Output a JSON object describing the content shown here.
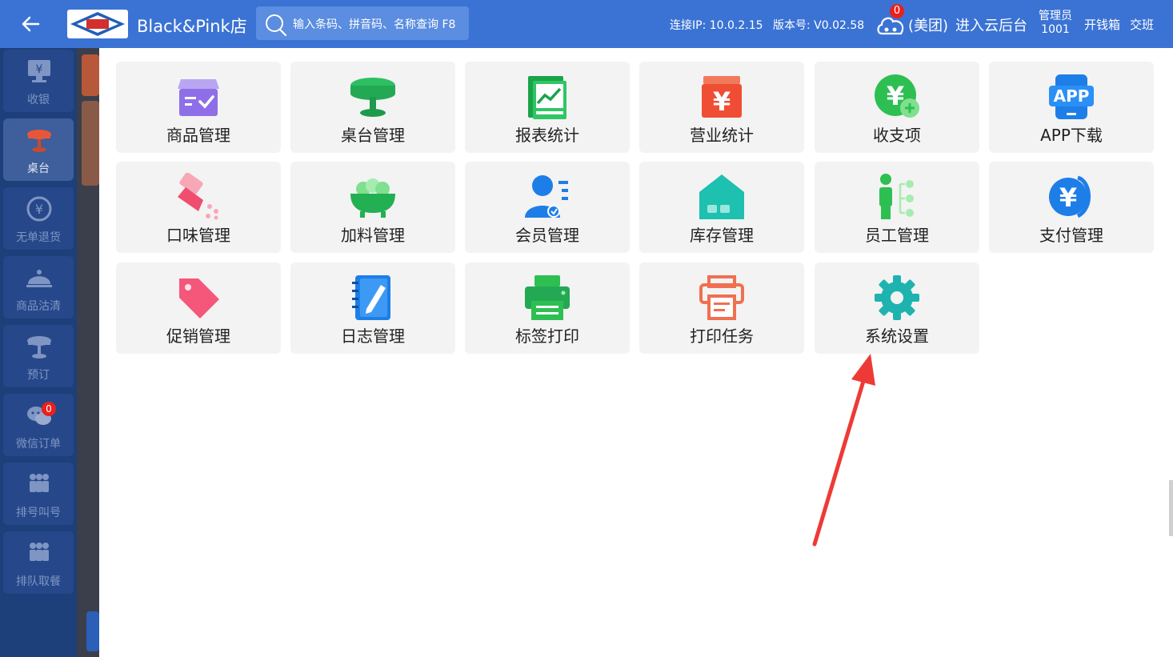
{
  "header": {
    "shop_name": "Black&Pink店",
    "search_placeholder": "输入条码、拼音码、名称查询 F8",
    "ip": "连接IP: 10.0.2.15",
    "version": "版本号: V0.02.58",
    "cloud_badge": "0",
    "meituan": "(美团)",
    "cloud_backend": "进入云后台",
    "admin_role": "管理员",
    "admin_id": "1001",
    "cash_box": "开钱箱",
    "shift": "交班"
  },
  "sidebar": {
    "items": [
      {
        "label": "收银"
      },
      {
        "label": "桌台"
      },
      {
        "label": "无单退货"
      },
      {
        "label": "商品沽清"
      },
      {
        "label": "预订"
      },
      {
        "label": "微信订单",
        "badge": "0"
      },
      {
        "label": "排号叫号"
      },
      {
        "label": "排队取餐"
      }
    ]
  },
  "grid": {
    "tiles": [
      {
        "label": "商品管理",
        "icon": "goods-box-icon"
      },
      {
        "label": "桌台管理",
        "icon": "table-icon"
      },
      {
        "label": "报表统计",
        "icon": "report-chart-icon"
      },
      {
        "label": "营业统计",
        "icon": "yen-box-icon"
      },
      {
        "label": "收支项",
        "icon": "yen-coin-icon"
      },
      {
        "label": "APP下载",
        "icon": "app-phone-icon"
      },
      {
        "label": "口味管理",
        "icon": "seasoning-icon"
      },
      {
        "label": "加料管理",
        "icon": "bowl-icon"
      },
      {
        "label": "会员管理",
        "icon": "member-icon"
      },
      {
        "label": "库存管理",
        "icon": "warehouse-icon"
      },
      {
        "label": "员工管理",
        "icon": "staff-tree-icon"
      },
      {
        "label": "支付管理",
        "icon": "payment-yen-icon"
      },
      {
        "label": "促销管理",
        "icon": "price-tag-icon"
      },
      {
        "label": "日志管理",
        "icon": "notebook-icon"
      },
      {
        "label": "标签打印",
        "icon": "printer-icon"
      },
      {
        "label": "打印任务",
        "icon": "print-task-icon"
      },
      {
        "label": "系统设置",
        "icon": "gear-icon"
      }
    ]
  },
  "colors": {
    "topbar": "#3b73d4",
    "sidebar": "#1d3f7a",
    "tile_bg": "#f3f3f3",
    "annotation_arrow": "#ee3a36"
  }
}
